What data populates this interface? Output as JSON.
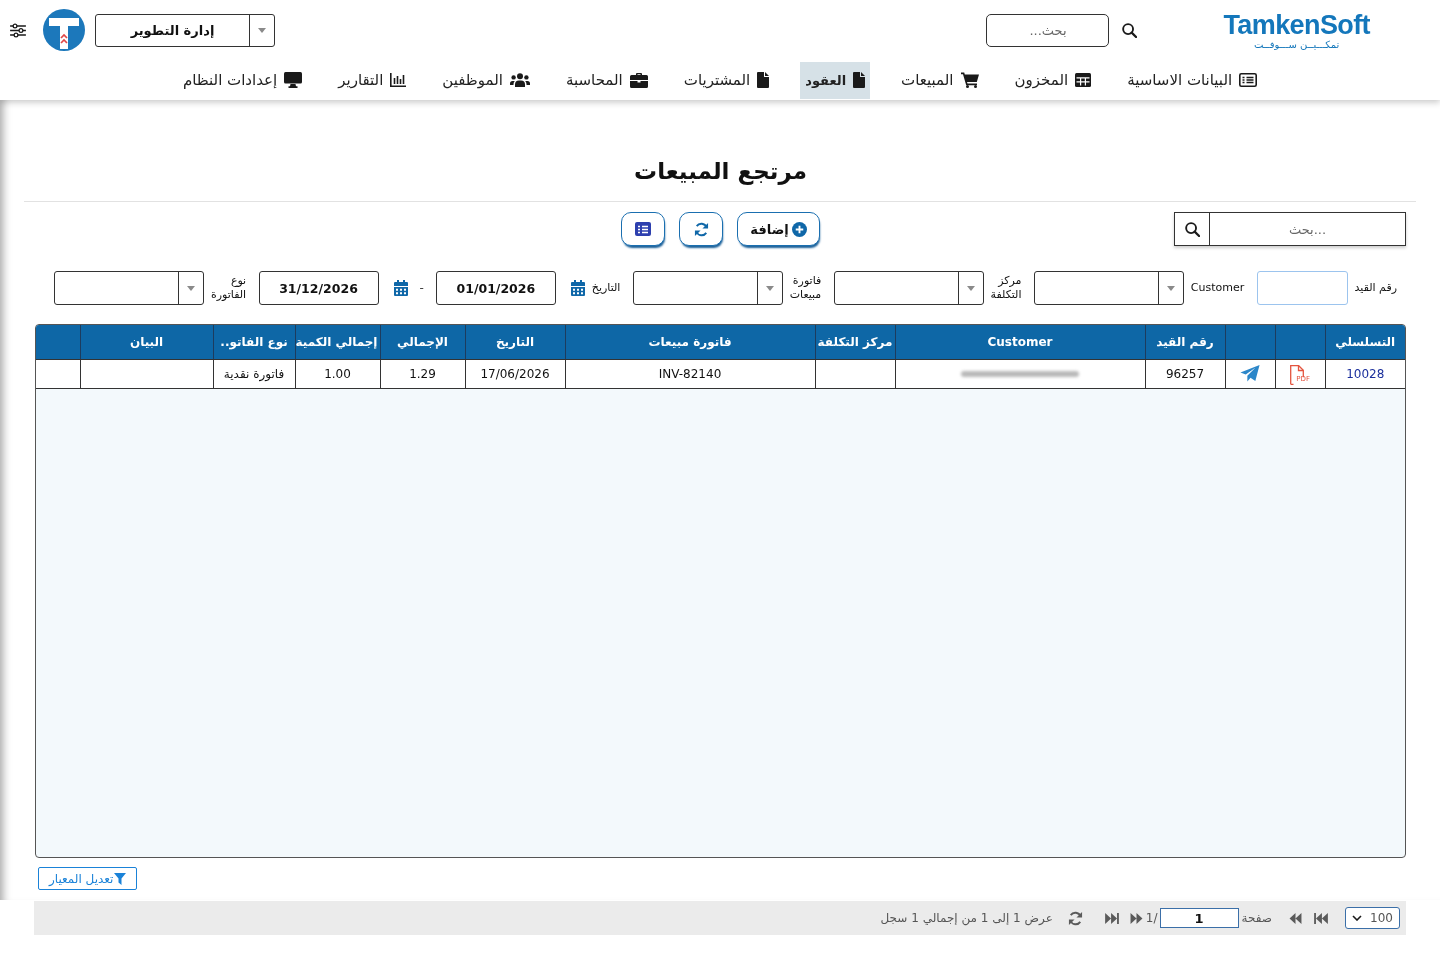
{
  "header": {
    "logo": {
      "name": "TamkenSoft",
      "tagline": "تمكـــيــن ســـوفــت"
    },
    "search": {
      "placeholder": "بحث..."
    },
    "department": "إدارة التطوير"
  },
  "nav": [
    {
      "kind": "list",
      "label": "البيانات الاساسية",
      "selected": false
    },
    {
      "kind": "table",
      "label": "المخزون",
      "selected": false
    },
    {
      "kind": "cart",
      "label": "المبيعات",
      "selected": false
    },
    {
      "kind": "file",
      "label": "العقود",
      "selected": true
    },
    {
      "kind": "file",
      "label": "المشتريات",
      "selected": false
    },
    {
      "kind": "briefcase",
      "label": "المحاسبة",
      "selected": false
    },
    {
      "kind": "users",
      "label": "الموظفين",
      "selected": false
    },
    {
      "kind": "chart",
      "label": "التقارير",
      "selected": false
    },
    {
      "kind": "desktop",
      "label": "إعدادات النظام",
      "selected": false
    }
  ],
  "page": {
    "title": "مرتجع المبيعات"
  },
  "toolbar": {
    "search": {
      "placeholder": "بحث..."
    },
    "buttons": [
      {
        "kind": "add",
        "label": "إضافة"
      },
      {
        "kind": "refresh"
      },
      {
        "kind": "list"
      }
    ]
  },
  "filters": [
    {
      "kind": "text",
      "label": "رقم القيد",
      "focused": true
    },
    {
      "kind": "select",
      "label": "Customer",
      "focused": false
    },
    {
      "kind": "select",
      "label": "مركز التكلفة",
      "focused": false
    },
    {
      "kind": "select",
      "label": "فاتورة مبيعات",
      "focused": false
    },
    {
      "kind": "date_range",
      "label": "التاريخ",
      "from": "01/01/2026",
      "separator": "-",
      "to": "31/12/2026",
      "focused": false
    },
    {
      "kind": "select",
      "label": "نوع الفاتورة",
      "focused": false
    }
  ],
  "table": {
    "columns": [
      {
        "kind": "link",
        "label": "التسلسلي"
      },
      {
        "kind": "pdf"
      },
      {
        "kind": "send"
      },
      {
        "kind": "text",
        "label": "رقم القيد"
      },
      {
        "kind": "blurred",
        "label": "Customer"
      },
      {
        "kind": "text",
        "label": "مركز التكلفة"
      },
      {
        "kind": "text",
        "label": "فاتورة مبيعات"
      },
      {
        "kind": "text",
        "label": "التاريخ"
      },
      {
        "kind": "text",
        "label": "الإجمالي"
      },
      {
        "kind": "text",
        "label": "إجمالي الكمية"
      },
      {
        "kind": "text",
        "label": "نوع الفاتو.."
      },
      {
        "kind": "text",
        "label": "البيان"
      },
      {
        "kind": "blank"
      }
    ],
    "rows": [
      {
        "serial": "10028",
        "pdf_label": "PDF",
        "entry_number": "96257",
        "customer": {
          "blurred": true
        },
        "sales_invoice": "INV-82140",
        "date": "17/06/2026",
        "total": "1.29",
        "total_quantity": "1.00",
        "invoice_type": "فاتورة نقدية"
      }
    ]
  },
  "criteria_button": {
    "label": "تعديل المعيار"
  },
  "pager": {
    "page_size": "100",
    "page_label": "صفحة",
    "page": "1",
    "page_total": "/1",
    "summary": "عرض 1 إلى 1 من إجمالي 1 سجل"
  }
}
